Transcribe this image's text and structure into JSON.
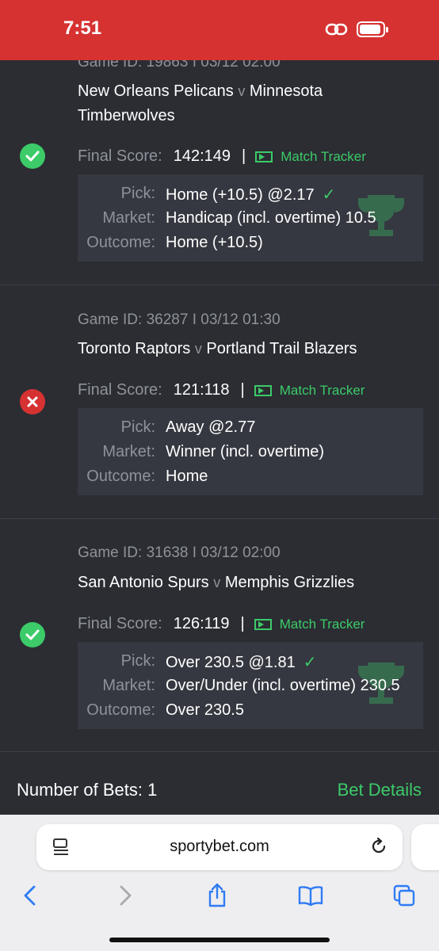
{
  "status_bar": {
    "time": "7:51"
  },
  "bets": [
    {
      "game_id_label": "Game ID:",
      "game_id": "19863",
      "date": "03/12 02:00",
      "home_team": "New Orleans Pelicans",
      "vs": "v",
      "away_team": "Minnesota Timberwolves",
      "final_score_label": "Final Score:",
      "final_score": "142:149",
      "tracker_label": "Match Tracker",
      "pick_label": "Pick:",
      "pick": "Home (+10.5) @2.17",
      "market_label": "Market:",
      "market": "Handicap (incl. overtime) 10.5",
      "outcome_label": "Outcome:",
      "outcome": "Home (+10.5)",
      "result": "won"
    },
    {
      "game_id_label": "Game ID:",
      "game_id": "36287",
      "date": "03/12 01:30",
      "home_team": "Toronto Raptors",
      "vs": "v",
      "away_team": "Portland Trail Blazers",
      "final_score_label": "Final Score:",
      "final_score": "121:118",
      "tracker_label": "Match Tracker",
      "pick_label": "Pick:",
      "pick": "Away @2.77",
      "market_label": "Market:",
      "market": "Winner (incl. overtime)",
      "outcome_label": "Outcome:",
      "outcome": "Home",
      "result": "lost"
    },
    {
      "game_id_label": "Game ID:",
      "game_id": "31638",
      "date": "03/12 02:00",
      "home_team": "San Antonio Spurs",
      "vs": "v",
      "away_team": "Memphis Grizzlies",
      "final_score_label": "Final Score:",
      "final_score": "126:119",
      "tracker_label": "Match Tracker",
      "pick_label": "Pick:",
      "pick": "Over 230.5 @1.81",
      "market_label": "Market:",
      "market": "Over/Under (incl. overtime) 230.5",
      "outcome_label": "Outcome:",
      "outcome": "Over 230.5",
      "result": "won"
    }
  ],
  "footer": {
    "bets_label": "Number of Bets: 1",
    "details_label": "Bet Details"
  },
  "browser": {
    "url": "sportybet.com"
  },
  "colors": {
    "status_bar": "#d63232",
    "background": "#2b2d33",
    "accent_green": "#3ccb68",
    "lost_red": "#d63232"
  }
}
